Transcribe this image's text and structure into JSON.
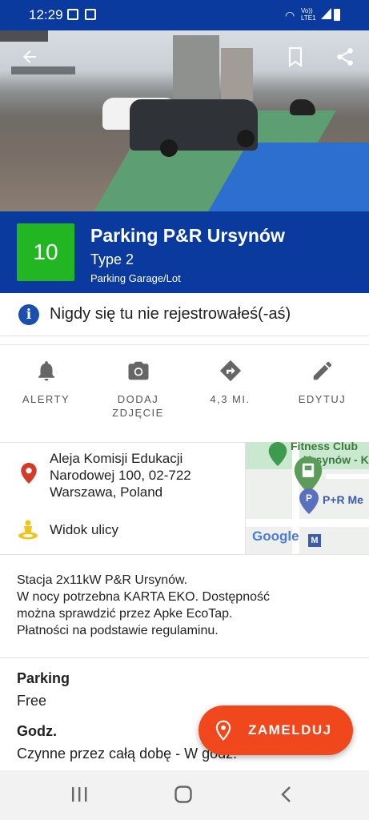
{
  "status_bar": {
    "time": "12:29",
    "network_label": "Vo)) LTE1"
  },
  "hero": {
    "back_icon": "arrow-left-icon",
    "bookmark_icon": "bookmark-icon",
    "share_icon": "share-icon"
  },
  "header": {
    "score": "10",
    "title": "Parking P&R Ursynów",
    "connector_type": "Type 2",
    "location_kind": "Parking Garage/Lot",
    "score_color": "#22b622",
    "brand_color": "#0b3a9e"
  },
  "checkin_notice": {
    "text": "Nigdy się tu nie rejestrowałeś(-aś)",
    "icon": "info-icon"
  },
  "actions": [
    {
      "label": "ALERTY",
      "icon": "bell-icon"
    },
    {
      "label": "DODAJ\nZDJĘCIE",
      "icon": "camera-icon"
    },
    {
      "label": "4,3 MI.",
      "icon": "directions-icon"
    },
    {
      "label": "EDYTUJ",
      "icon": "pencil-icon"
    }
  ],
  "address": {
    "line1": "Aleja Komisji Edukacji",
    "line2": "Narodowej 100, 02-722",
    "line3": "Warszawa, Poland",
    "street_view": "Widok ulicy"
  },
  "map": {
    "label1": "Fitness Club",
    "label2": "Ursynów - K",
    "label3": "P+R Me",
    "google": "Google"
  },
  "description": "Stacja 2x11kW P&R Ursynów.\nW nocy potrzebna KARTA EKO. Dostępność\nmożna sprawdzić przez Apke EcoTap.\nPłatności na podstawie regulaminu.",
  "details": {
    "parking_label": "Parking",
    "parking_value": "Free",
    "hours_label": "Godz.",
    "hours_value": "Czynne przez całą dobę - W godz."
  },
  "fab": {
    "label": "ZAMELDUJ",
    "icon": "map-pin-icon",
    "color": "#f0471c"
  },
  "nav": {
    "recent_icon": "recent-apps-icon",
    "home_icon": "home-icon",
    "back_icon": "back-icon"
  }
}
